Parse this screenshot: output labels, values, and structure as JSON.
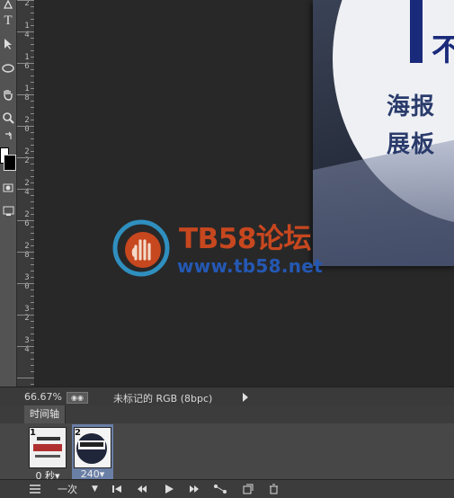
{
  "ruler": {
    "labels": [
      "2",
      "4",
      "6",
      "8",
      "0",
      "2",
      "4",
      "6",
      "8",
      "0",
      "2",
      "4"
    ],
    "label_prefix": [
      "1",
      "1",
      "1",
      "1",
      "2",
      "2",
      "2",
      "2",
      "2",
      "3",
      "3",
      "3"
    ]
  },
  "tools": [
    "pen-tool",
    "type-tool",
    "path-selection-tool",
    "shape-tool",
    "hand-tool",
    "zoom-tool",
    "swap-colors",
    "color-swatches",
    "quick-mask",
    "screen-mode"
  ],
  "tool_labels": {
    "type": "T"
  },
  "poster": {
    "big_glyph": "不",
    "line1": "海报",
    "line2": "展板"
  },
  "watermark": {
    "title": "TB58论坛",
    "url": "www.tb58.net"
  },
  "status": {
    "zoom": "66.67%",
    "doc_info": "未标记的 RGB (8bpc)"
  },
  "timeline": {
    "tab_label": "时间轴",
    "frames": [
      {
        "number": "1",
        "delay": "0 秒▾",
        "selected": false
      },
      {
        "number": "2",
        "delay": "240▾",
        "selected": true
      }
    ],
    "loop_option": "一次"
  },
  "colors": {
    "panel": "#535353",
    "canvas_bg": "#282828",
    "selected_frame": "#6a7fa6",
    "watermark_red": "#c7471f",
    "watermark_blue": "#2458b4"
  }
}
